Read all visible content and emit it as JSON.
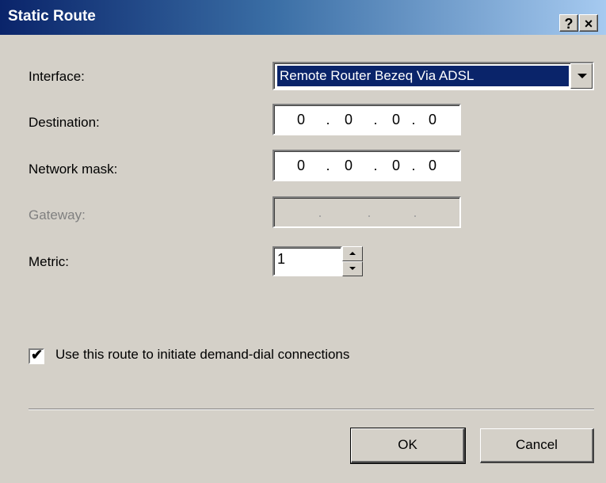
{
  "window": {
    "title": "Static Route",
    "help_label": "?",
    "close_label": "×"
  },
  "form": {
    "interface": {
      "label": "Interface:",
      "value": "Remote Router Bezeq Via ADSL"
    },
    "destination": {
      "label": "Destination:",
      "octets": [
        "0",
        "0",
        "0",
        "0"
      ]
    },
    "network_mask": {
      "label": "Network mask:",
      "octets": [
        "0",
        "0",
        "0",
        "0"
      ]
    },
    "gateway": {
      "label": "Gateway:",
      "octets": [
        "",
        "",
        "",
        ""
      ]
    },
    "metric": {
      "label": "Metric:",
      "value": "1"
    },
    "demand_dial": {
      "checked": true,
      "label": "Use this route to initiate demand-dial connections"
    }
  },
  "buttons": {
    "ok": "OK",
    "cancel": "Cancel"
  },
  "icons": {
    "combo_arrow": "chevron-down-icon",
    "spin_up": "arrow-up-icon",
    "spin_down": "arrow-down-icon",
    "check": "checkmark-icon"
  },
  "colors": {
    "title_gradient_start": "#0a246a",
    "title_gradient_end": "#a6caf0",
    "selection": "#0a246a",
    "face": "#d4d0c8"
  }
}
